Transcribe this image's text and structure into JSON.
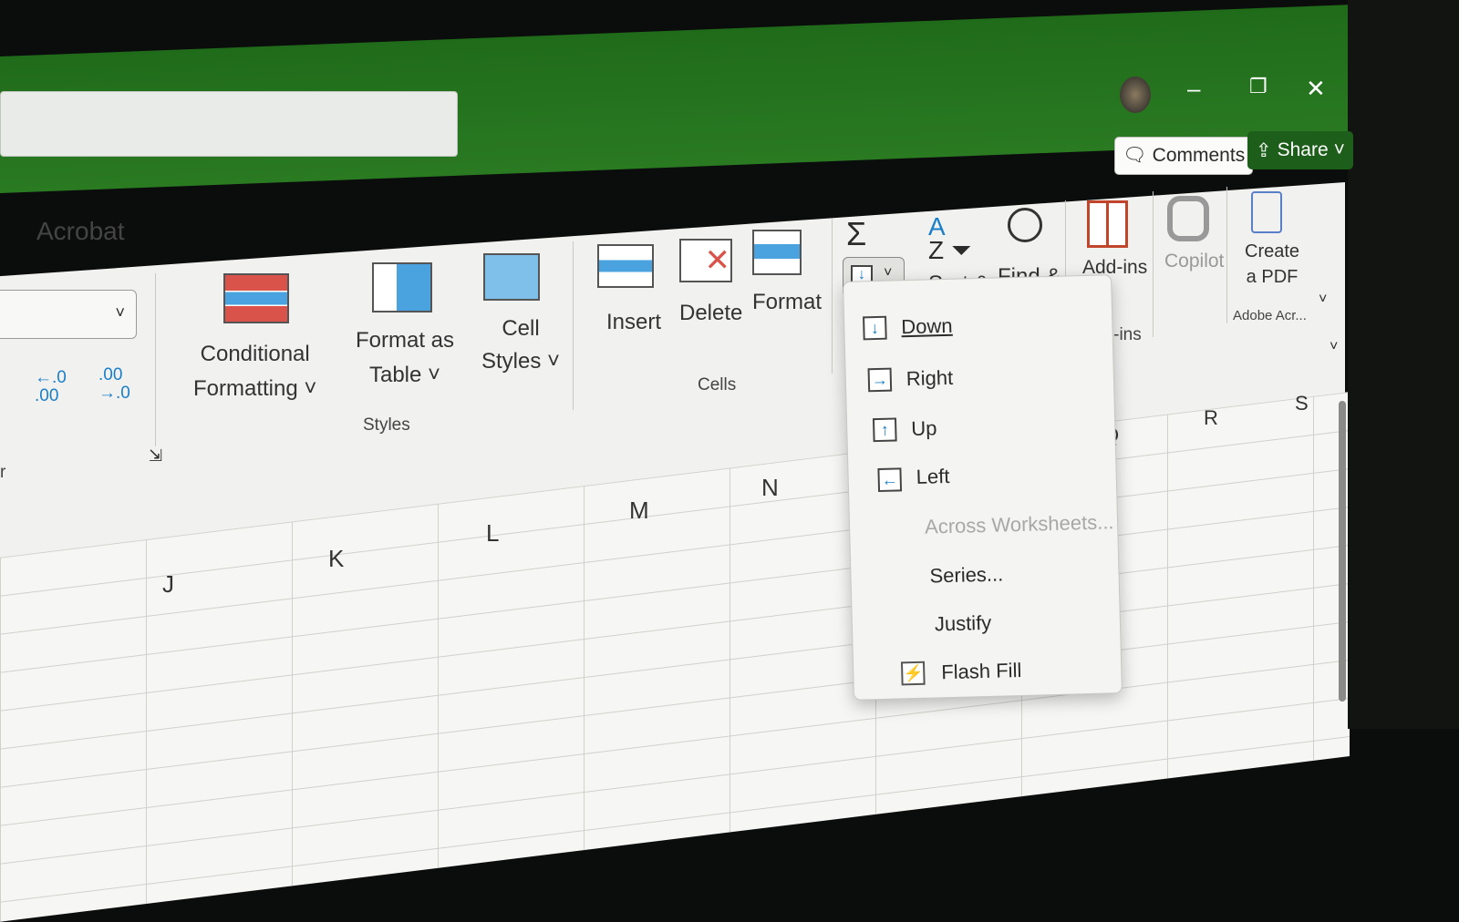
{
  "window": {
    "minimize": "–",
    "restore": "❐",
    "close": "✕"
  },
  "header": {
    "comments_label": "Comments",
    "share_label": "Share"
  },
  "tabs": {
    "acrobat": "Acrobat"
  },
  "number_group": {
    "increase_decimal": "←.0 .00",
    "decrease_decimal": ".00 →.0",
    "label_fragment": "r"
  },
  "styles_group": {
    "conditional_formatting": [
      "Conditional",
      "Formatting ˅"
    ],
    "format_as_table": [
      "Format as",
      "Table ˅"
    ],
    "cell_styles": [
      "Cell",
      "Styles ˅"
    ],
    "label": "Styles"
  },
  "cells_group": {
    "insert": "Insert",
    "delete": "Delete",
    "format": "Format",
    "label": "Cells"
  },
  "editing_group": {
    "sum": "Σ",
    "sort_filter": "Sort &",
    "find_select": "Find &"
  },
  "addins_group": {
    "addins": "Add-ins",
    "label": "dd-ins"
  },
  "copilot": {
    "label": "Copilot"
  },
  "adobe_group": {
    "create_pdf": [
      "Create",
      "a PDF"
    ],
    "label": "Adobe Acr..."
  },
  "fill_menu": {
    "items": [
      {
        "label": "Down",
        "icon": "fill-down-icon",
        "enabled": true
      },
      {
        "label": "Right",
        "icon": "fill-right-icon",
        "enabled": true
      },
      {
        "label": "Up",
        "icon": "fill-up-icon",
        "enabled": true
      },
      {
        "label": "Left",
        "icon": "fill-left-icon",
        "enabled": true
      },
      {
        "label": "Across Worksheets...",
        "enabled": false
      },
      {
        "label": "Series...",
        "enabled": true
      },
      {
        "label": "Justify",
        "enabled": true
      },
      {
        "label": "Flash Fill",
        "icon": "flash-fill-icon",
        "enabled": true
      }
    ]
  },
  "columns": [
    "J",
    "K",
    "L",
    "M",
    "N",
    "Q",
    "R",
    "S"
  ],
  "colors": {
    "title_bar": "#1f6b1a",
    "share": "#1d5e1a",
    "accent_blue": "#1a7fc9",
    "accent_red": "#d9534a"
  }
}
